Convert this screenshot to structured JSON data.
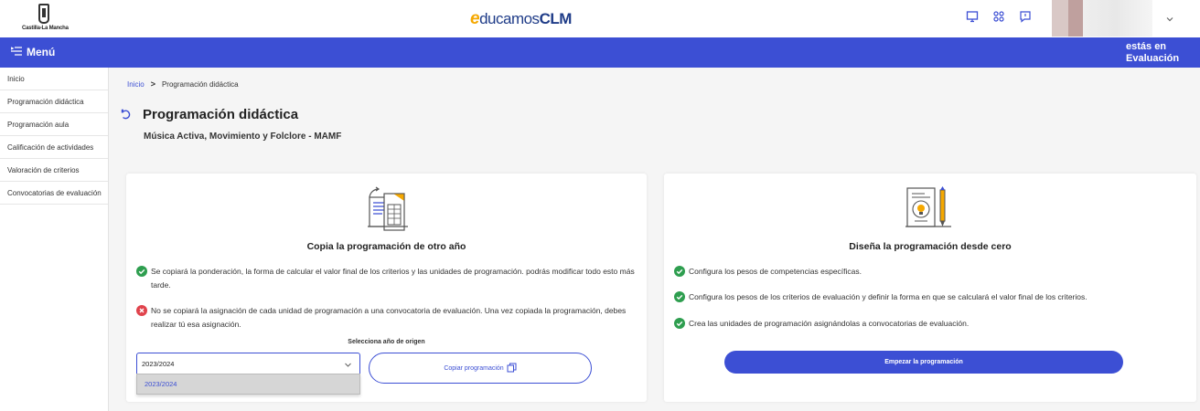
{
  "header": {
    "org_logo_text": "Castilla-La Mancha",
    "brand_e": "e",
    "brand_mid": "ducamos",
    "brand_clm": "CLM",
    "icons": [
      "monitor-icon",
      "apps-grid-icon",
      "chat-icon",
      "chevron-down-icon"
    ]
  },
  "menubar": {
    "menu_label": "Menú",
    "context_line1": "estás en",
    "context_line2": "Evaluación"
  },
  "sidebar": {
    "items": [
      {
        "label": "Inicio"
      },
      {
        "label": "Programación didáctica"
      },
      {
        "label": "Programación aula"
      },
      {
        "label": "Calificación de actividades"
      },
      {
        "label": "Valoración de criterios"
      },
      {
        "label": "Convocatorias de evaluación"
      }
    ]
  },
  "breadcrumb": {
    "home": "Inicio",
    "separator": ">",
    "current": "Programación didáctica"
  },
  "page": {
    "title": "Programación didáctica",
    "subtitle": "Música Activa, Movimiento y Folclore - MAMF"
  },
  "copy_card": {
    "title": "Copia la programación de otro año",
    "info_ok": "Se copiará la ponderación, la forma de calcular el valor final de los criterios y las unidades de programación. podrás modificar todo esto más tarde.",
    "info_no": "No se copiará la asignación de cada unidad de programación a una convocatoria de evaluación. Una vez copiada la programación, debes realizar tú esa asignación.",
    "select_label": "Selecciona año de origen",
    "selected_value": "2023/2024",
    "options": [
      "2023/2024"
    ],
    "copy_button": "Copiar programación"
  },
  "new_card": {
    "title": "Diseña la programación desde cero",
    "items": [
      "Configura los pesos de competencias específicas.",
      "Configura los pesos de los criterios de evaluación y definir la forma en que se calculará el valor final de los criterios.",
      "Crea las unidades de programación asignándolas a convocatorias de evaluación."
    ],
    "start_button": "Empezar la programación"
  },
  "colors": {
    "primary": "#3c4fd4",
    "success": "#2e9e4f",
    "error": "#e0434c",
    "brand_accent": "#f5a800"
  }
}
